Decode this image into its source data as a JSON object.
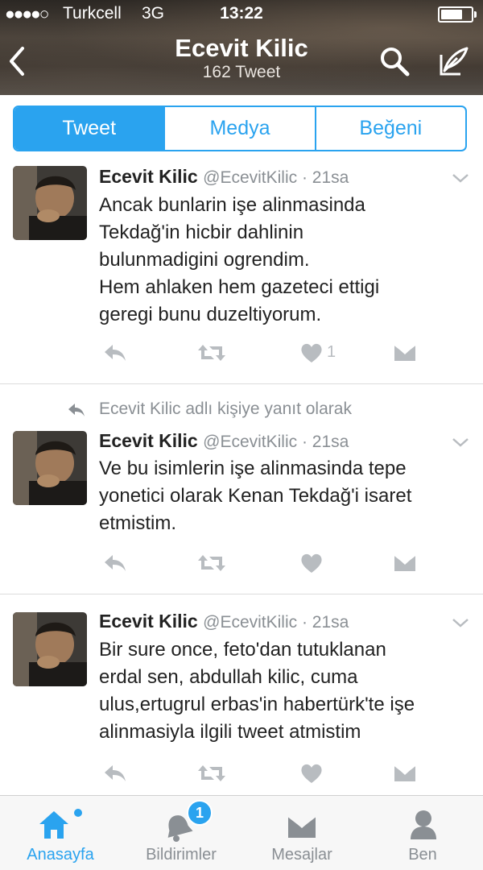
{
  "status_bar": {
    "signal": "●●●●○",
    "carrier": "Turkcell",
    "network": "3G",
    "time": "13:22"
  },
  "header": {
    "title": "Ecevit Kilic",
    "subtitle": "162 Tweet"
  },
  "tabs": [
    {
      "label": "Tweet",
      "active": true
    },
    {
      "label": "Medya",
      "active": false
    },
    {
      "label": "Beğeni",
      "active": false
    }
  ],
  "tweets": [
    {
      "name": "Ecevit Kilic",
      "handle": "@EcevitKilic · 21sa",
      "lines": [
        "Ancak bunlarin işe alinmasinda",
        "Tekdağ'in hicbir dahlinin",
        "bulunmadigini ogrendim.",
        "Hem ahlaken hem gazeteci ettigi",
        "geregi bunu duzeltiyorum."
      ],
      "like_count": "1"
    },
    {
      "reply_context": "Ecevit Kilic adlı kişiye yanıt olarak",
      "name": "Ecevit Kilic",
      "handle": "@EcevitKilic · 21sa",
      "lines": [
        "Ve bu isimlerin işe alinmasinda tepe",
        "yonetici olarak Kenan Tekdağ'i isaret",
        "etmistim."
      ],
      "like_count": ""
    },
    {
      "name": "Ecevit Kilic",
      "handle": "@EcevitKilic · 21sa",
      "lines": [
        "Bir sure once, feto'dan tutuklanan",
        "erdal sen, abdullah kilic, cuma",
        "ulus,ertugrul erbas'in habertürk'te işe",
        "alinmasiyla ilgili tweet atmistim"
      ],
      "like_count": ""
    }
  ],
  "tabbar": [
    {
      "label": "Anasayfa",
      "icon": "home-icon",
      "active": true
    },
    {
      "label": "Bildirimler",
      "icon": "bell-icon",
      "badge": "1"
    },
    {
      "label": "Mesajlar",
      "icon": "envelope-icon"
    },
    {
      "label": "Ben",
      "icon": "person-icon"
    }
  ],
  "colors": {
    "accent": "#2aa3ef",
    "text": "#222222",
    "muted": "#8a8f94"
  }
}
